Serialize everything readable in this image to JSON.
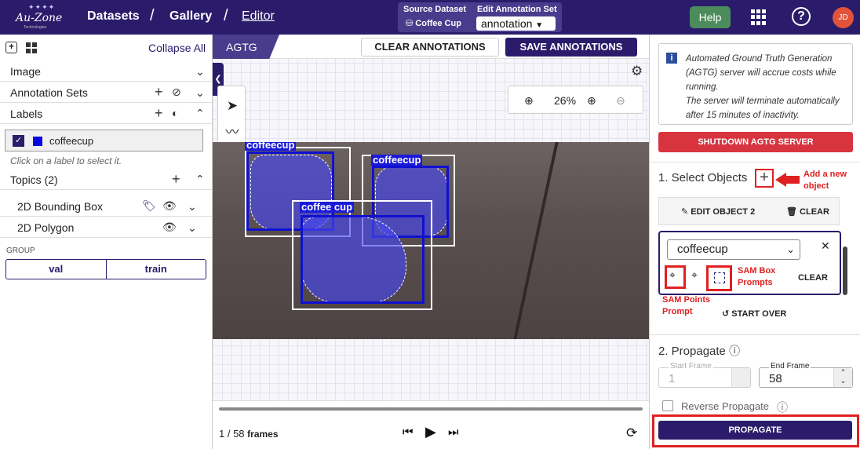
{
  "header": {
    "logo_text": "Au-Zone",
    "logo_sub": "Technologies",
    "nav": [
      "Datasets",
      "Gallery",
      "Editor"
    ],
    "source_dataset_label": "Source Dataset",
    "source_dataset_value": "Coffee Cup",
    "annotation_set_label": "Edit Annotation Set",
    "annotation_set_value": "annotation",
    "help_label": "Help",
    "avatar_initials": "JD"
  },
  "left": {
    "collapse_all": "Collapse All",
    "sections": {
      "image": "Image",
      "annotation_sets": "Annotation Sets",
      "labels": "Labels"
    },
    "label_item": "coffeecup",
    "label_color": "#0a0ae0",
    "hint": "Click on a label to select it.",
    "topics_title": "Topics (2)",
    "topics": [
      "2D Bounding Box",
      "2D Polygon"
    ],
    "group_label": "GROUP",
    "group_options": [
      "val",
      "train"
    ]
  },
  "center": {
    "tab": "AGTG",
    "clear_annotations": "CLEAR ANNOTATIONS",
    "save_annotations": "SAVE ANNOTATIONS",
    "zoom": "26%",
    "annotation_label": "coffeecup",
    "annotation_label_partial": "coffee",
    "annotation_label_tail": "cup",
    "frame_counter": "1 / 58",
    "frames_word": "frames"
  },
  "right": {
    "info_line1": "Automated Ground Truth Generation (AGTG) server will accrue costs while running.",
    "info_line2": "The server will terminate automatically after 15 minutes of inactivity.",
    "shutdown": "SHUTDOWN AGTG SERVER",
    "select_objects": "1. Select Objects",
    "add_note": "Add a new object",
    "edit_object": "EDIT OBJECT 2",
    "clear": "CLEAR",
    "object_value": "coffeecup",
    "sam_box": "SAM Box Prompts",
    "sam_points": "SAM Points Prompt",
    "card_clear": "CLEAR",
    "start_over": "START OVER",
    "propagate_title": "2. Propagate",
    "start_frame_label": "Start Frame",
    "start_frame_value": "1",
    "end_frame_label": "End Frame",
    "end_frame_value": "58",
    "reverse": "Reverse Propagate",
    "propagate_btn": "PROPAGATE"
  }
}
